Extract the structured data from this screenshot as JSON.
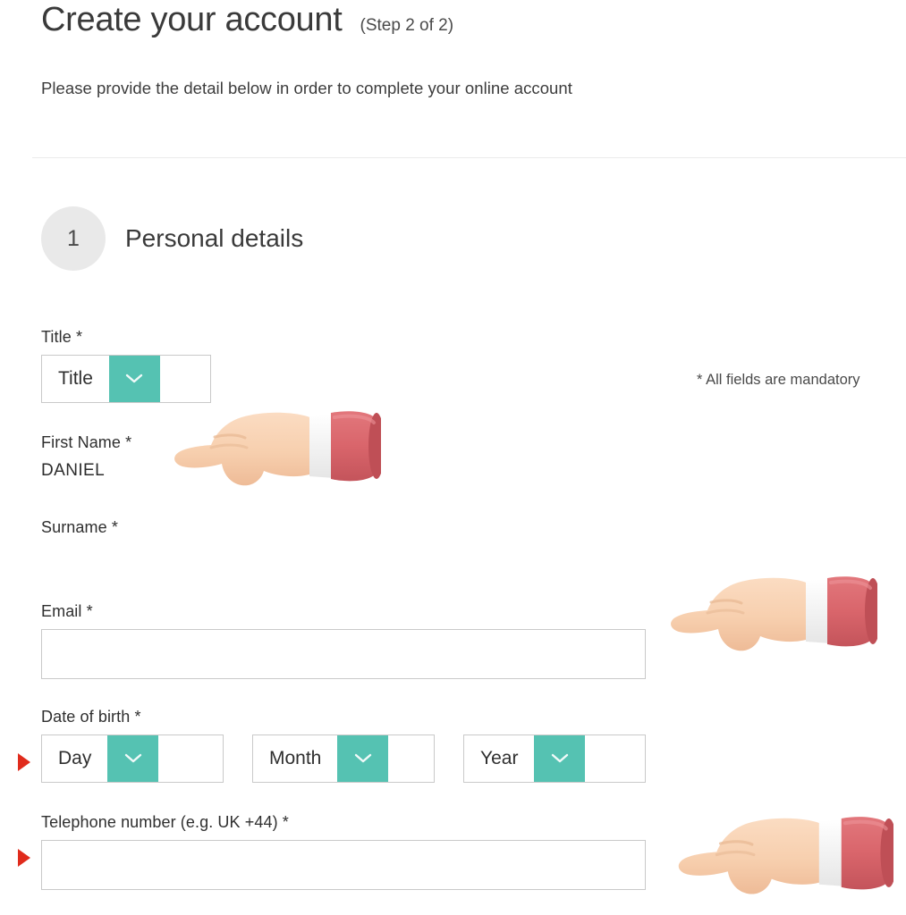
{
  "header": {
    "title": "Create your account",
    "step": "(Step 2 of 2)",
    "subtitle": "Please provide the detail below in order to complete your online account"
  },
  "section": {
    "number": "1",
    "title": "Personal details"
  },
  "notice": {
    "mandatory": "* All fields are mandatory"
  },
  "form": {
    "title": {
      "label": "Title *",
      "value": "Title",
      "arrow_icon": "chevron-down-icon"
    },
    "first_name": {
      "label": "First Name *",
      "value": "DANIEL"
    },
    "surname": {
      "label": "Surname *",
      "value": ""
    },
    "email": {
      "label": "Email *",
      "value": "",
      "placeholder": ""
    },
    "dob": {
      "label": "Date of birth *",
      "day": {
        "value": "Day",
        "arrow_icon": "chevron-down-icon"
      },
      "month": {
        "value": "Month",
        "arrow_icon": "chevron-down-icon"
      },
      "year": {
        "value": "Year",
        "arrow_icon": "chevron-down-icon"
      }
    },
    "telephone": {
      "label": "Telephone number (e.g. UK +44) *",
      "value": "",
      "placeholder": ""
    }
  },
  "colors": {
    "accent_teal": "#55c2b2",
    "marker_red": "#e02b1c",
    "badge_grey": "#e9e9e9",
    "border_grey": "#c9c9c9",
    "sleeve_red": "#d9656b",
    "skin": "#f6cdae"
  },
  "annotations": {
    "pointer_hand_icon": "pointing-hand-emoji",
    "marker_icon": "red-triangle-marker"
  }
}
